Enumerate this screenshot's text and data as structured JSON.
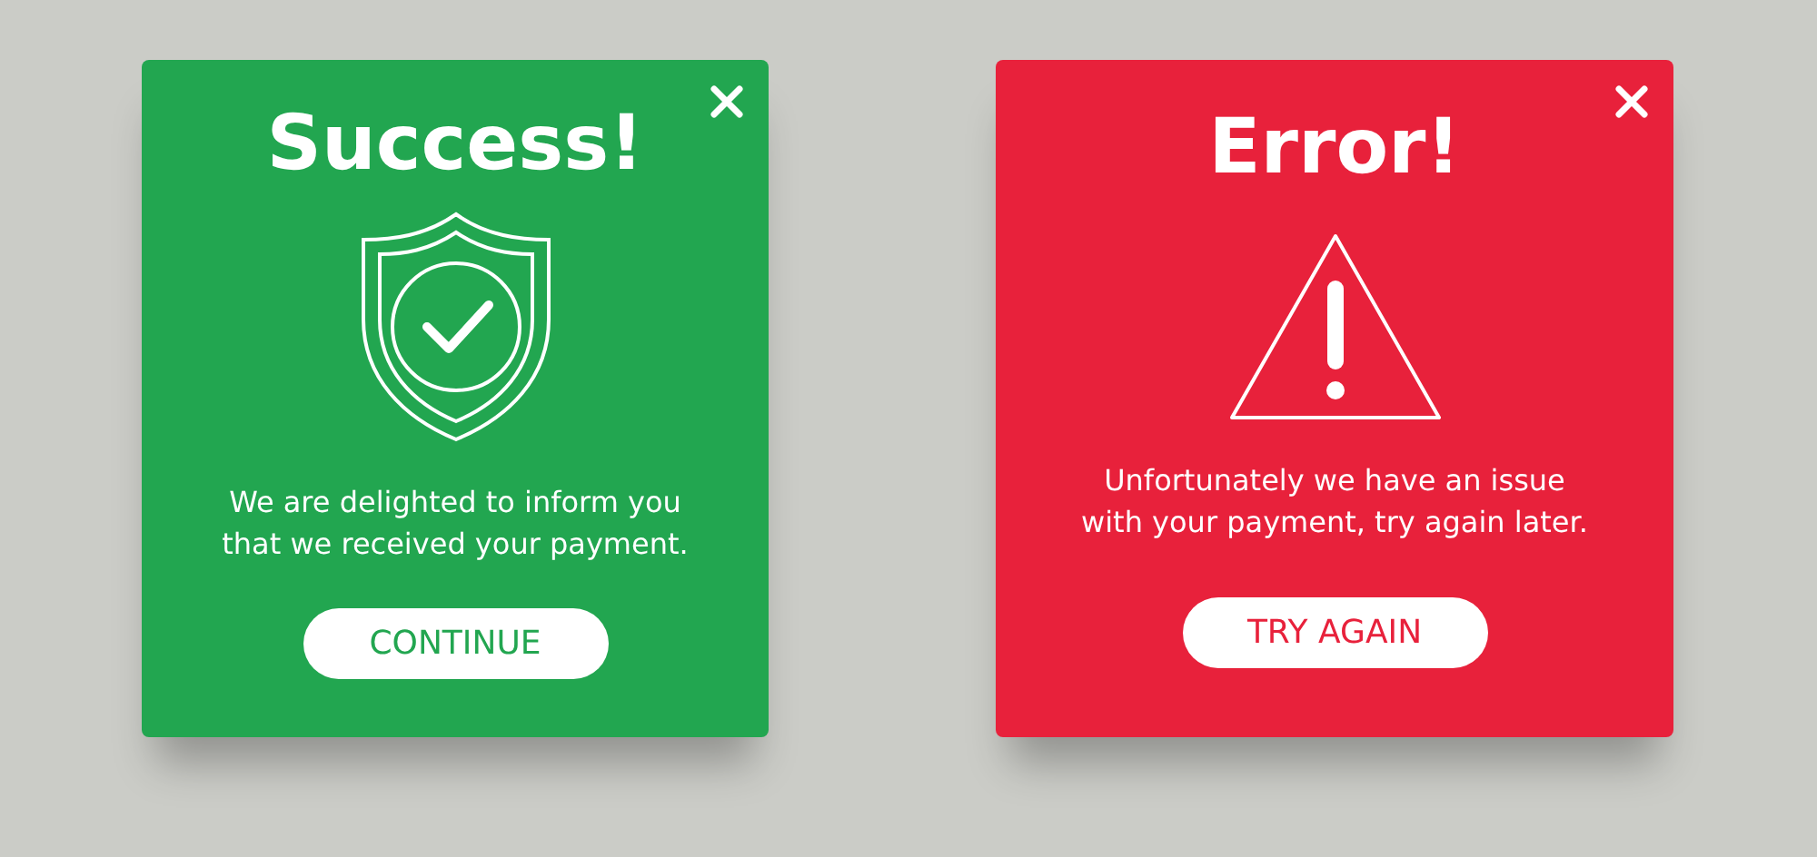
{
  "dialogs": [
    {
      "kind": "success",
      "color": "#22a650",
      "title": "Success!",
      "message": [
        "We are delighted to inform you",
        "that we received your payment."
      ],
      "button": "CONTINUE"
    },
    {
      "kind": "error",
      "color": "#e8213b",
      "title": "Error!",
      "message": [
        "Unfortunately we have an issue",
        "with your payment, try again later."
      ],
      "button": "TRY AGAIN"
    }
  ]
}
